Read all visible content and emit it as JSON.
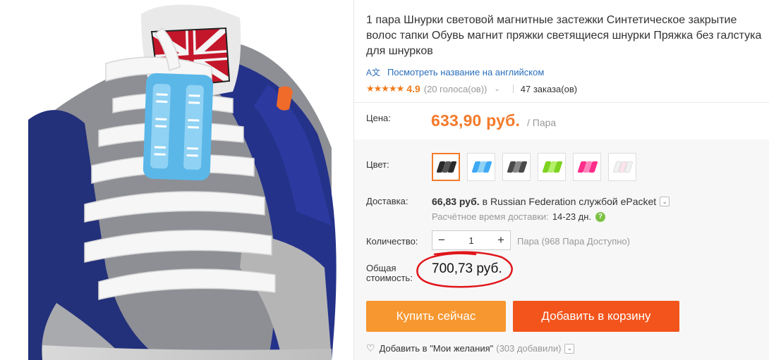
{
  "product": {
    "title": "1 пара Шнурки световой магнитные застежки Синтетическое закрытие волос тапки Обувь магнит пряжки светящиеся шнурки Пряжка без галстука для шнурков",
    "translate_label": "Посмотреть название на английском",
    "translate_icon": "translate-icon",
    "rating": {
      "stars_icon": "star-icon",
      "value": "4.9",
      "votes": "(20 голоса(ов))",
      "orders": "47 заказа(ов)"
    }
  },
  "price": {
    "label": "Цена:",
    "value": "633,90 руб.",
    "unit": "/ Пара"
  },
  "color": {
    "label": "Цвет:",
    "options": [
      {
        "name": "black",
        "color": "#2b2b2b",
        "selected": true
      },
      {
        "name": "blue",
        "color": "#3fa9f5",
        "selected": false
      },
      {
        "name": "dark-gray",
        "color": "#4a4a4a",
        "selected": false
      },
      {
        "name": "green",
        "color": "#7ed321",
        "selected": false
      },
      {
        "name": "pink",
        "color": "#ff2d8a",
        "selected": false
      },
      {
        "name": "white",
        "color": "#f0f0f0",
        "selected": false
      }
    ]
  },
  "shipping": {
    "label": "Доставка:",
    "cost": "66,83 руб.",
    "destination": "в Russian Federation службой ePacket",
    "eta_label": "Расчётное время доставки:",
    "eta_value": "14-23 дн."
  },
  "quantity": {
    "label": "Количество:",
    "minus": "−",
    "value": "1",
    "plus": "+",
    "available": "Пара (968 Пара Доступно)"
  },
  "total": {
    "label": "Общая стоимость:",
    "value": "700,73 руб."
  },
  "actions": {
    "buy_now": "Купить сейчас",
    "add_to_cart": "Добавить в корзину",
    "wishlist": "Добавить в \"Мои желания\"",
    "wishlist_count": "(303 добавили)"
  },
  "colors": {
    "accent_orange": "#f47a2a",
    "buy_button": "#f7972f",
    "cart_button": "#f2541b",
    "link_blue": "#2a6ebb",
    "annotation_red": "#e0161b"
  }
}
